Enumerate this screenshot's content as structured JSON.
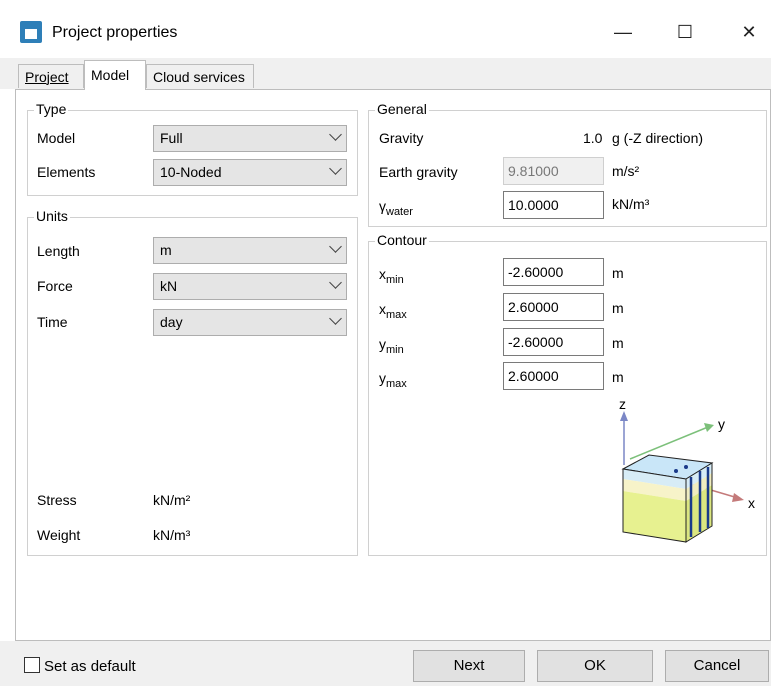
{
  "window": {
    "title": "Project properties",
    "minimize_symbol": "—",
    "maximize_symbol": "☐",
    "close_symbol": "✕"
  },
  "tabs": [
    "Project",
    "Model",
    "Cloud services"
  ],
  "type_group": {
    "title": "Type",
    "model_label": "Model",
    "model_value": "Full",
    "elements_label": "Elements",
    "elements_value": "10-Noded"
  },
  "units_group": {
    "title": "Units",
    "length_label": "Length",
    "length_value": "m",
    "force_label": "Force",
    "force_value": "kN",
    "time_label": "Time",
    "time_value": "day",
    "stress_label": "Stress",
    "stress_value": "kN/m²",
    "weight_label": "Weight",
    "weight_value": "kN/m³"
  },
  "general_group": {
    "title": "General",
    "gravity_label": "Gravity",
    "gravity_value": "1.0",
    "gravity_unit": "g (-Z direction)",
    "earth_gravity_label": "Earth gravity",
    "earth_gravity_value": "9.81000",
    "earth_gravity_unit": "m/s²",
    "gamma_symbol": "γ",
    "gamma_sub": "water",
    "gamma_value": "10.0000",
    "gamma_unit": "kN/m³"
  },
  "contour_group": {
    "title": "Contour",
    "rows": [
      {
        "var": "x",
        "sub": "min",
        "value": "-2.60000",
        "unit": "m"
      },
      {
        "var": "x",
        "sub": "max",
        "value": "2.60000",
        "unit": "m"
      },
      {
        "var": "y",
        "sub": "min",
        "value": "-2.60000",
        "unit": "m"
      },
      {
        "var": "y",
        "sub": "max",
        "value": "2.60000",
        "unit": "m"
      }
    ],
    "axis_z": "z",
    "axis_y": "y",
    "axis_x": "x"
  },
  "footer": {
    "set_default_label": "Set as default",
    "next_label": "Next",
    "ok_label": "OK",
    "cancel_label": "Cancel"
  }
}
